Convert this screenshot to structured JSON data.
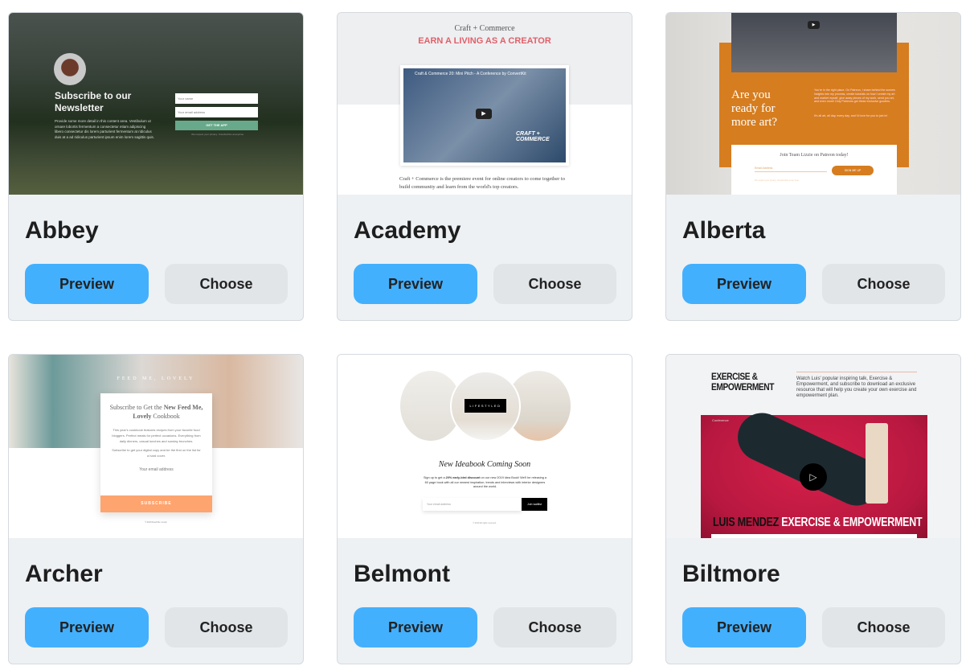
{
  "templates": [
    {
      "name": "Abbey",
      "preview_label": "Preview",
      "choose_label": "Choose",
      "thumb": {
        "heading": "Subscribe to our Newsletter",
        "body": "Provide some more detail in this content area. Vestibulum ut ornare lobortis fermentum a consectetur etiam adipiscing libero consectetur dis lorem parturient fermentum at ridiculus duis at a ad ridiculus parturient ipsum enim lorem sagittis quis.",
        "name_placeholder": "Your name",
        "email_placeholder": "Your email address",
        "cta": "GET THE APP",
        "privacy": "We respect your privacy. Unsubscribe at anytime."
      }
    },
    {
      "name": "Academy",
      "preview_label": "Preview",
      "choose_label": "Choose",
      "thumb": {
        "kicker": "Craft + Commerce",
        "heading": "EARN A LIVING AS A CREATOR",
        "video_title": "Craft & Commerce 20: Mini Pitch - A Conference by ConvertKit",
        "video_logo": "CRAFT + COMMERCE",
        "body": "Craft + Commerce is the premiere event for online creators to come together to build community and learn from the world's top creators."
      }
    },
    {
      "name": "Alberta",
      "preview_label": "Preview",
      "choose_label": "Choose",
      "thumb": {
        "heading": "Are you ready for more art?",
        "body": "You're in the right place. On Patreon, I share behind the scenes insights into my process, create tutorials on how I create my art and market myself, give away pieces of my work, send you art, and even more! Only Patreons get these exclusive goodies.",
        "body2": "It's all art, all day, every day, and I'd love for you to join in!",
        "form_title": "Join Team Lizzie on Patreon today!",
        "email_placeholder": "Email Address",
        "cta": "SIGN ME UP",
        "privacy": "We respect your privacy. Unsubscribe at any time."
      }
    },
    {
      "name": "Archer",
      "preview_label": "Preview",
      "choose_label": "Choose",
      "thumb": {
        "brand": "FEED ME, LOVELY",
        "heading_pre": "Subscribe to Get the ",
        "heading_bold1": "New Feed Me, Lovely",
        "heading_post": " Cookbook",
        "body": "This year's cookbook features recipes from your favorite food bloggers. Perfect meals for perfect occasions. Everything from daily dinners, casual lunches and sunday brunches.",
        "body2": "Subscribe to get your digital copy and be the first on the list for a hard cover.",
        "email_placeholder": "Your email address",
        "cta": "SUBSCRIBE",
        "footer": "© 2019 Feed Me, Lovely"
      }
    },
    {
      "name": "Belmont",
      "preview_label": "Preview",
      "choose_label": "Choose",
      "thumb": {
        "badge": "LIFESTYLED",
        "heading": "New Ideabook Coming Soon",
        "body_pre": "Sign up to get a ",
        "body_bold": "20% early-bird discount",
        "body_post": " on our new 2019 Idea Book! We'll be releasing a 60 page book with all our newest inspiration, trends and interviews with interior designers around the world.",
        "email_placeholder": "Your email address",
        "cta": "Join waitlist",
        "footer": "© 2019 All rights reserved."
      }
    },
    {
      "name": "Biltmore",
      "preview_label": "Preview",
      "choose_label": "Choose",
      "thumb": {
        "heading": "EXERCISE & EMPOWERMENT",
        "body": "Watch Luis' popular inspiring talk, Exercise & Empowerment, and subscribe to download an exclusive resource that will help you create your own exercise and empowerment plan.",
        "channel": "Conference",
        "banner_dark": "LUIS MENDEZ",
        "banner_light": "EXERCISE & EMPOWERMENT"
      }
    }
  ],
  "colors": {
    "preview_button": "#43b0fe",
    "choose_button": "#e1e5e8",
    "card_footer": "#edf1f4",
    "alberta_orange": "#d67d1f",
    "archer_peach": "#fea46f",
    "biltmore_red": "#d6204a"
  }
}
